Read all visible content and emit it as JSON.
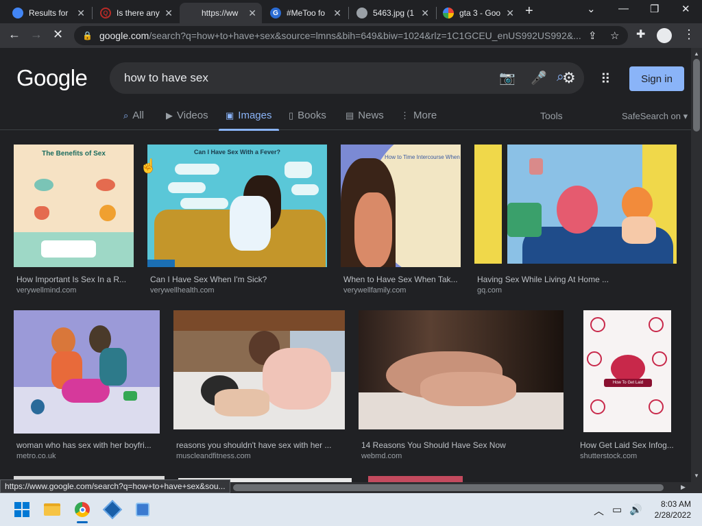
{
  "browser": {
    "tabs": [
      {
        "title": "Results for",
        "favicon": "blue-chrome-icon",
        "color": "#4285f4"
      },
      {
        "title": "Is there any",
        "favicon": "quora-icon",
        "color": "#b92b27"
      },
      {
        "title": "https://ww",
        "favicon": "blank-icon",
        "color": "#35363a"
      },
      {
        "title": "#MeToo fo",
        "favicon": "google-g-icon",
        "color": "#2b6cd4"
      },
      {
        "title": "5463.jpg (1",
        "favicon": "globe-icon",
        "color": "#9aa0a6"
      },
      {
        "title": "gta 3 - Goo",
        "favicon": "google-icon",
        "color": "#ea4335"
      }
    ],
    "url_host": "google.com",
    "url_rest": "/search?q=how+to+have+sex&source=lmns&bih=649&biw=1024&rlz=1C1GCEU_enUS992US992&..."
  },
  "google": {
    "logo": "Google",
    "query": "how to have sex",
    "signin": "Sign in",
    "tabs": [
      {
        "label": "All",
        "icon": "search-icon"
      },
      {
        "label": "Videos",
        "icon": "video-icon"
      },
      {
        "label": "Images",
        "icon": "image-icon"
      },
      {
        "label": "Books",
        "icon": "book-icon"
      },
      {
        "label": "News",
        "icon": "news-icon"
      },
      {
        "label": "More",
        "icon": "more-icon"
      }
    ],
    "tools": "Tools",
    "safesearch": "SafeSearch on"
  },
  "results": [
    {
      "caption": "How Important Is Sex In a R...",
      "source": "verywellmind.com",
      "overlay": "The Benefits of Sex"
    },
    {
      "caption": "Can I Have Sex When I'm Sick?",
      "source": "verywellhealth.com",
      "overlay": "Can I Have Sex With a Fever?"
    },
    {
      "caption": "When to Have Sex When Tak...",
      "source": "verywellfamily.com",
      "overlay": "How to Time Intercourse When"
    },
    {
      "caption": "Having Sex While Living At Home ...",
      "source": "gq.com",
      "overlay": ""
    },
    {
      "caption": "woman who has sex with her boyfri...",
      "source": "metro.co.uk",
      "overlay": ""
    },
    {
      "caption": "reasons you shouldn't have sex with her ...",
      "source": "muscleandfitness.com",
      "overlay": ""
    },
    {
      "caption": "14 Reasons You Should Have Sex Now",
      "source": "webmd.com",
      "overlay": ""
    },
    {
      "caption": "How Get Laid Sex Infog...",
      "source": "shutterstock.com",
      "overlay": "How To Get Laid"
    }
  ],
  "status_url": "https://www.google.com/search?q=how+to+have+sex&sou...",
  "clock": {
    "time": "8:03 AM",
    "date": "2/28/2022"
  }
}
